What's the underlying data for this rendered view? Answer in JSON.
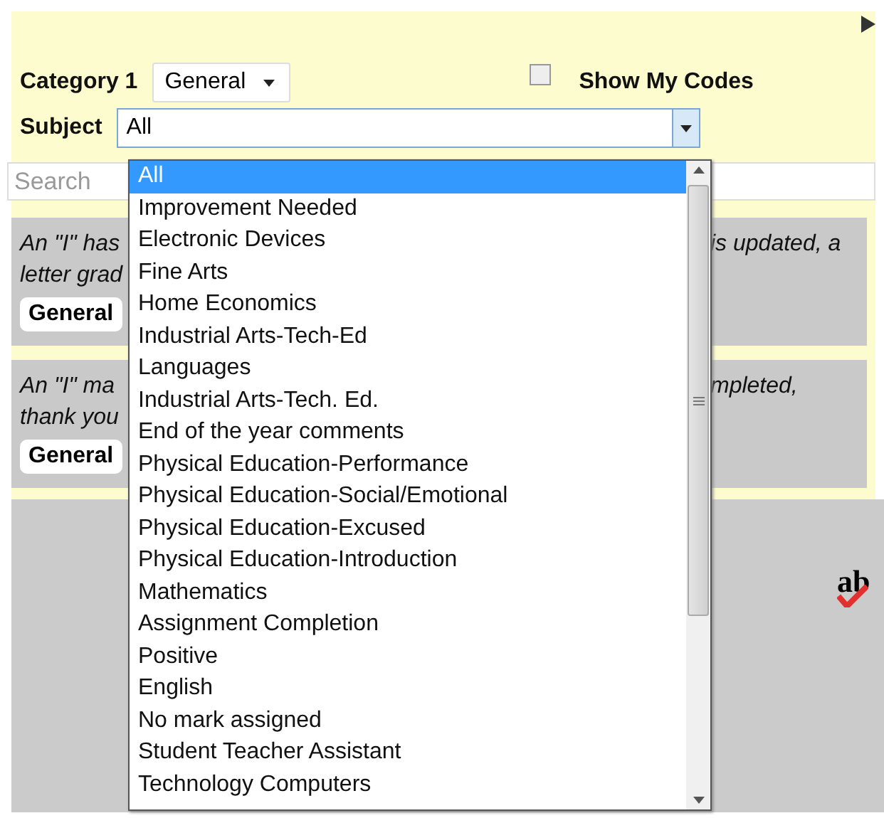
{
  "form": {
    "category_label": "Category 1",
    "category_value": "General",
    "show_my_codes": {
      "label": "Show My Codes",
      "checked": false
    },
    "subject_label": "Subject",
    "subject_value": "All",
    "search": {
      "placeholder": "Search"
    }
  },
  "cards": [
    {
      "left_lines": [
        "An \"I\" has",
        "letter grad"
      ],
      "right_text": "is updated, a",
      "tag": "General"
    },
    {
      "left_lines": [
        "An \"I\" ma",
        "thank you"
      ],
      "right_text": "mpleted,",
      "tag": "General"
    }
  ],
  "logo_text": "ab",
  "dropdown": {
    "options": [
      {
        "label": "All",
        "selected": true
      },
      {
        "label": "Improvement Needed",
        "selected": false
      },
      {
        "label": "Electronic Devices",
        "selected": false
      },
      {
        "label": "Fine Arts",
        "selected": false
      },
      {
        "label": "Home Economics",
        "selected": false
      },
      {
        "label": "Industrial Arts-Tech-Ed",
        "selected": false
      },
      {
        "label": "Languages",
        "selected": false
      },
      {
        "label": "Industrial Arts-Tech. Ed.",
        "selected": false
      },
      {
        "label": "End of the year comments",
        "selected": false
      },
      {
        "label": "Physical Education-Performance",
        "selected": false
      },
      {
        "label": "Physical Education-Social/Emotional",
        "selected": false
      },
      {
        "label": "Physical Education-Excused",
        "selected": false
      },
      {
        "label": "Physical Education-Introduction",
        "selected": false
      },
      {
        "label": "Mathematics",
        "selected": false
      },
      {
        "label": "Assignment Completion",
        "selected": false
      },
      {
        "label": "Positive",
        "selected": false
      },
      {
        "label": "English",
        "selected": false
      },
      {
        "label": "No mark assigned",
        "selected": false
      },
      {
        "label": "Student Teacher Assistant",
        "selected": false
      },
      {
        "label": "Technology Computers",
        "selected": false
      }
    ]
  }
}
